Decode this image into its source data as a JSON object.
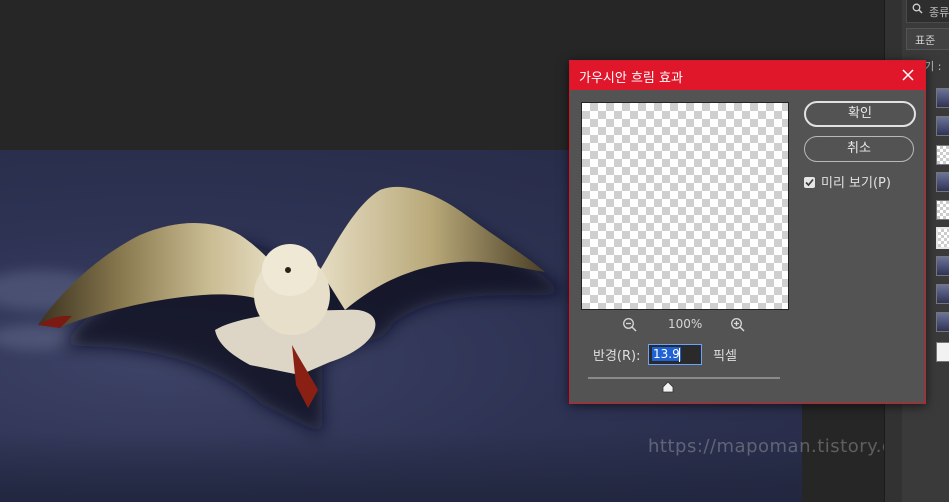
{
  "dialog": {
    "title": "가우시안 흐림 효과",
    "zoom_level": "100%",
    "ok_label": "확인",
    "cancel_label": "취소",
    "preview_label": "미리 보기(P)",
    "preview_checked": true,
    "radius_label": "반경(R):",
    "radius_value": "13.9",
    "radius_unit": "픽셀"
  },
  "panel": {
    "search_label": "종류",
    "blend_mode": "표준",
    "opacity_label": "고기 :"
  },
  "watermark": "https://mapoman.tistory.com",
  "colors": {
    "title_bar": "#e0162b",
    "dialog_bg": "#535353",
    "workspace_bg": "#262626",
    "selection": "#1f62d6"
  }
}
